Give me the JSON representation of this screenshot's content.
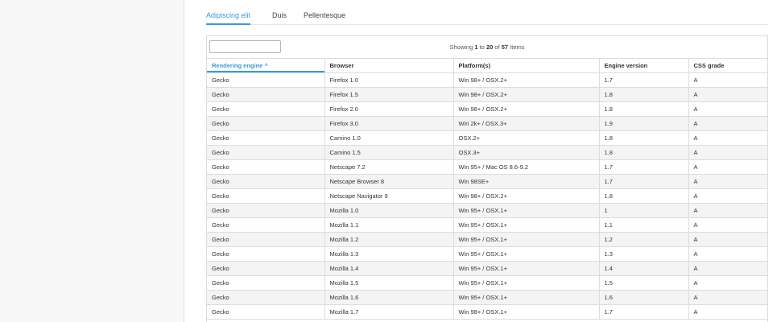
{
  "tabs": [
    {
      "label": "Adipiscing elit",
      "active": true
    },
    {
      "label": "Duis",
      "active": false
    },
    {
      "label": "Pellentesque",
      "active": false
    }
  ],
  "table": {
    "search_value": "",
    "showing": {
      "prefix": "Showing ",
      "from": "1",
      "to_word": " to ",
      "to": "20",
      "of_word": " of ",
      "total": "57",
      "suffix": " Items"
    },
    "sort_indicator": "^",
    "columns": [
      "Rendering engine",
      "Browser",
      "Platform(s)",
      "Engine version",
      "CSS grade"
    ],
    "rows": [
      [
        "Gecko",
        "Firefox 1.0",
        "Win 98+ / OSX.2+",
        "1.7",
        "A"
      ],
      [
        "Gecko",
        "Firefox 1.5",
        "Win 98+ / OSX.2+",
        "1.8",
        "A"
      ],
      [
        "Gecko",
        "Firefox 2.0",
        "Win 98+ / OSX.2+",
        "1.8",
        "A"
      ],
      [
        "Gecko",
        "Firefox 3.0",
        "Win 2k+ / OSX.3+",
        "1.9",
        "A"
      ],
      [
        "Gecko",
        "Camino 1.0",
        "OSX.2+",
        "1.8",
        "A"
      ],
      [
        "Gecko",
        "Camino 1.5",
        "OSX.3+",
        "1.8",
        "A"
      ],
      [
        "Gecko",
        "Netscape 7.2",
        "Win 95+ / Mac OS 8.6-9.2",
        "1.7",
        "A"
      ],
      [
        "Gecko",
        "Netscape Browser 8",
        "Win 98SE+",
        "1.7",
        "A"
      ],
      [
        "Gecko",
        "Netscape Navigator 9",
        "Win 98+ / OSX.2+",
        "1.8",
        "A"
      ],
      [
        "Gecko",
        "Mozilla 1.0",
        "Win 95+ / OSX.1+",
        "1",
        "A"
      ],
      [
        "Gecko",
        "Mozilla 1.1",
        "Win 95+ / OSX.1+",
        "1.1",
        "A"
      ],
      [
        "Gecko",
        "Mozilla 1.2",
        "Win 95+ / OSX.1+",
        "1.2",
        "A"
      ],
      [
        "Gecko",
        "Mozilla 1.3",
        "Win 95+ / OSX.1+",
        "1.3",
        "A"
      ],
      [
        "Gecko",
        "Mozilla 1.4",
        "Win 95+ / OSX.1+",
        "1.4",
        "A"
      ],
      [
        "Gecko",
        "Mozilla 1.5",
        "Win 95+ / OSX.1+",
        "1.5",
        "A"
      ],
      [
        "Gecko",
        "Mozilla 1.6",
        "Win 95+ / OSX.1+",
        "1.6",
        "A"
      ],
      [
        "Gecko",
        "Mozilla 1.7",
        "Win 98+ / OSX.1+",
        "1.7",
        "A"
      ]
    ]
  },
  "colors": {
    "accent": "#3a9ad9",
    "row_alt": "#f4f4f4",
    "border": "#dcdcdc"
  }
}
